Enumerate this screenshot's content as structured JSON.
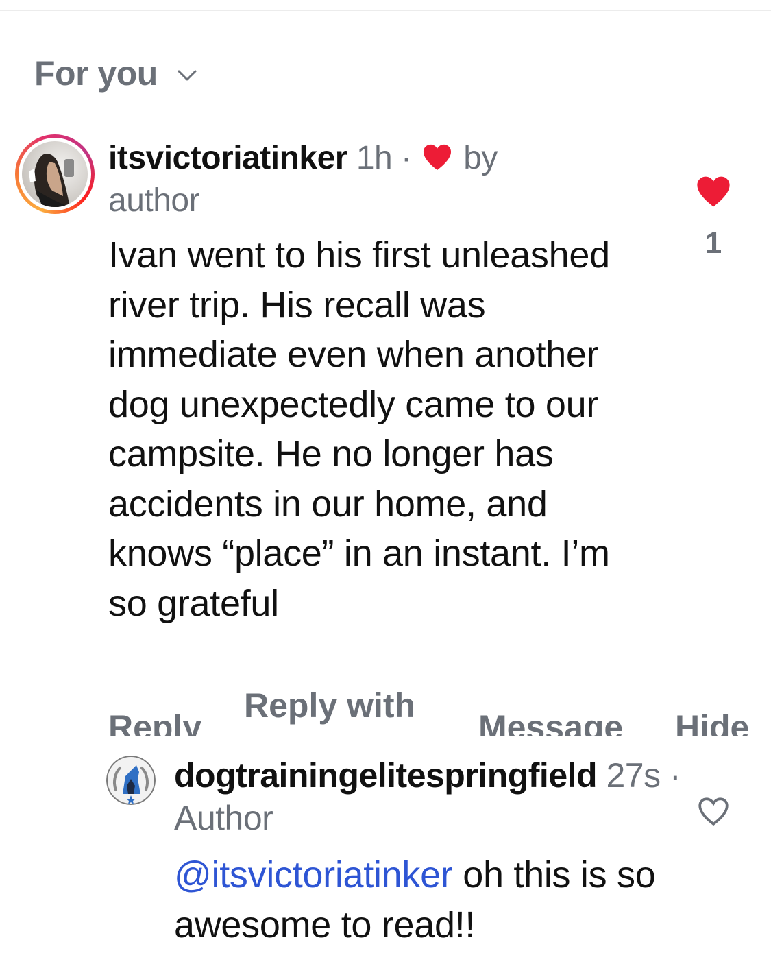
{
  "filter": {
    "label": "For you",
    "chevron_icon": "chevron-down-icon"
  },
  "comments": [
    {
      "username": "itsvictoriatinker",
      "time": "1h",
      "separator": "·",
      "liked_by_author_text": "by author",
      "body": "Ivan went to his first unleashed river trip. His recall was immediate even when another dog unexpectedly came to our campsite. He no longer has accidents in our home, and knows “place” in an instant. I’m so grateful",
      "like_count": "1",
      "liked": true,
      "heart_color": "#ed1c36"
    },
    {
      "username": "dogtrainingelitespringfield",
      "time": "27s",
      "separator": "·",
      "role": "Author",
      "mention": "@itsvictoriatinker",
      "body": " oh this is so awesome to read!!",
      "liked": false
    }
  ],
  "actions": {
    "reply": "Reply",
    "reply_with": "Reply with",
    "message": "Message",
    "hide": "Hide"
  },
  "colors": {
    "meta_gray": "#6b7078",
    "mention_blue": "#2e55d4",
    "like_red": "#ed1c36"
  }
}
